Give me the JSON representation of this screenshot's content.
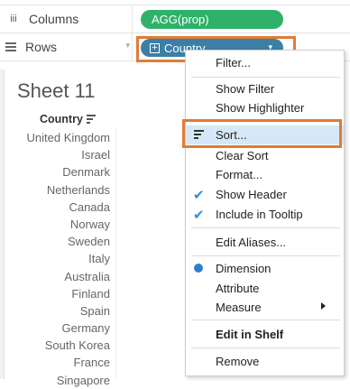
{
  "shelves": {
    "columns": {
      "icon": "iii",
      "label": "Columns",
      "pill": "AGG(prop)"
    },
    "rows": {
      "label": "Rows",
      "caret": "▾",
      "pill": "Country",
      "pill_caret": "▾"
    }
  },
  "sheet": {
    "title": "Sheet 11",
    "column_header": "Country",
    "countries": [
      "United Kingdom",
      "Israel",
      "Denmark",
      "Netherlands",
      "Canada",
      "Norway",
      "Sweden",
      "Italy",
      "Australia",
      "Finland",
      "Spain",
      "Germany",
      "South Korea",
      "France",
      "Singapore"
    ]
  },
  "menu": {
    "filter": "Filter...",
    "show_filter": "Show Filter",
    "show_highlighter": "Show Highlighter",
    "sort": "Sort...",
    "clear_sort": "Clear Sort",
    "format": "Format...",
    "show_header": "Show Header",
    "include_in_tooltip": "Include in Tooltip",
    "edit_aliases": "Edit Aliases...",
    "dimension": "Dimension",
    "attribute": "Attribute",
    "measure": "Measure",
    "edit_in_shelf": "Edit in Shelf",
    "remove": "Remove",
    "check_glyph": "✔"
  },
  "colors": {
    "green_pill": "#2fb16a",
    "blue_pill": "#3b7fa6",
    "highlight_orange": "#e07b35",
    "menu_selected": "#d6e8f7",
    "check_blue": "#2f8fdb"
  },
  "icons": [
    "columns-icon",
    "rows-icon",
    "sort-icon",
    "check-icon",
    "radio-dot-icon",
    "submenu-arrow-icon"
  ]
}
